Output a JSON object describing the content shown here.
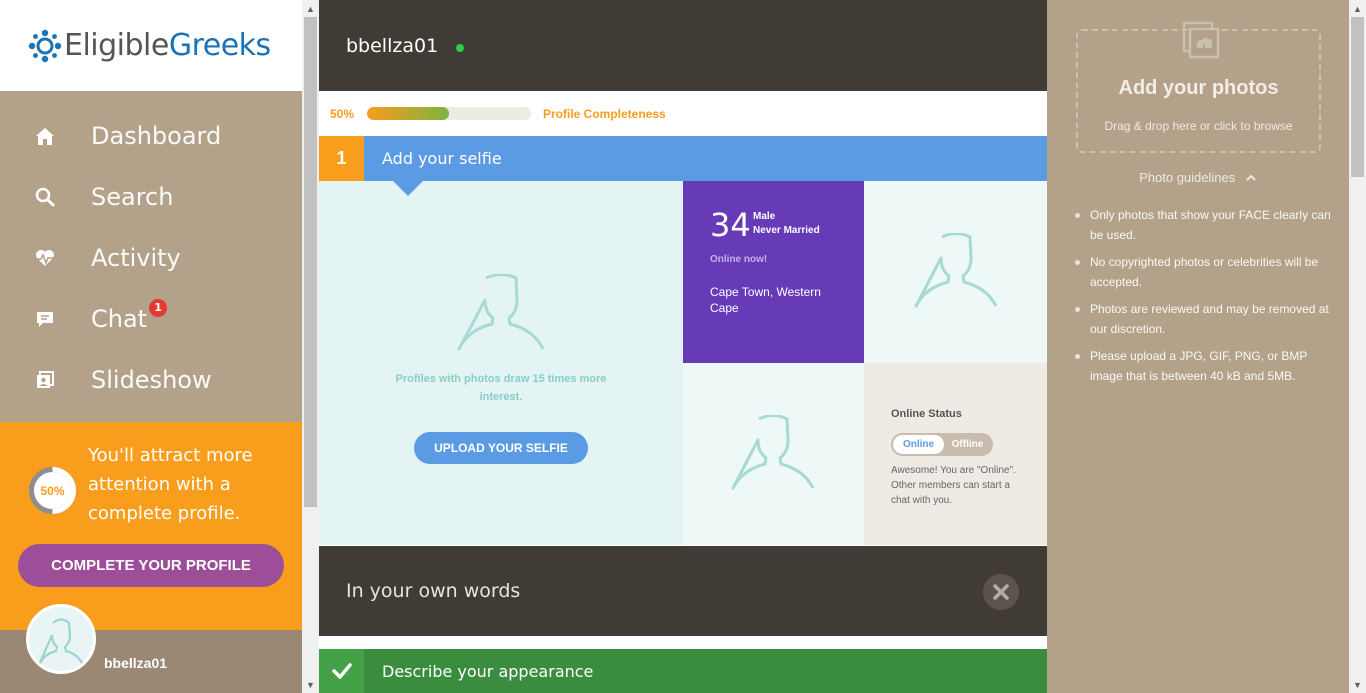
{
  "logo": {
    "part1": "Eligible",
    "part2": "Greeks"
  },
  "nav": [
    {
      "label": "Dashboard",
      "icon": "home-icon"
    },
    {
      "label": "Search",
      "icon": "search-icon"
    },
    {
      "label": "Activity",
      "icon": "heartbeat-icon"
    },
    {
      "label": "Chat",
      "icon": "chat-icon",
      "badge": "1"
    },
    {
      "label": "Slideshow",
      "icon": "slideshow-icon"
    }
  ],
  "promo": {
    "percent_label": "50%",
    "percent": 50,
    "text": "You'll attract more attention with a complete profile.",
    "button": "COMPLETE YOUR PROFILE"
  },
  "user_card": {
    "name": "bbellza01"
  },
  "modal": {
    "username": "bbellza01",
    "progress": {
      "percent_label": "50%",
      "percent": 50,
      "label": "Profile Completeness"
    },
    "step1": {
      "number": "1",
      "title": "Add your selfie"
    },
    "selfie": {
      "message": "Profiles with photos draw 15 times more interest.",
      "button": "UPLOAD YOUR SELFIE"
    },
    "profile_info": {
      "age": "34",
      "gender": "Male",
      "marital": "Never Married",
      "online": "Online now!",
      "location": "Cape Town, Western Cape"
    },
    "status": {
      "title": "Online Status",
      "online_label": "Online",
      "offline_label": "Offline",
      "description": "Awesome! You are \"Online\". Other members can start a chat with you."
    },
    "words": {
      "title": "In your own words"
    },
    "appearance": {
      "title": "Describe your appearance"
    }
  },
  "photos_panel": {
    "title": "Add your photos",
    "subtitle": "Drag & drop here or click to browse",
    "guidelines_label": "Photo guidelines",
    "guidelines": [
      "Only photos that show your FACE clearly can be used.",
      "No copyrighted photos or celebrities will be accepted.",
      "Photos are reviewed and may be removed at our discretion.",
      "Please upload a JPG, GIF, PNG, or BMP image that is between 40 kB and 5MB."
    ]
  },
  "colors": {
    "accent_orange": "#f99d1c",
    "accent_blue": "#5b9be3",
    "accent_purple": "#673ab7",
    "accent_green": "#43a047",
    "brand_blue": "#1a73b8",
    "sidebar_bg": "#b3a18a",
    "header_dark": "#403b35"
  }
}
